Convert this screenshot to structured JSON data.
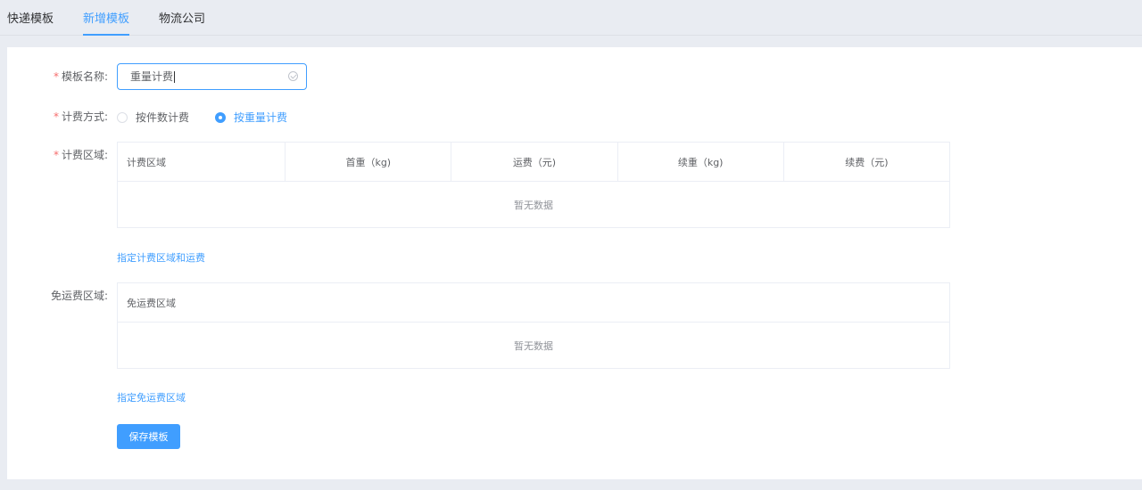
{
  "tabs": [
    {
      "label": "快递模板",
      "active": false
    },
    {
      "label": "新增模板",
      "active": true
    },
    {
      "label": "物流公司",
      "active": false
    }
  ],
  "form": {
    "name": {
      "required_mark": "*",
      "label": "模板名称:",
      "value": "重量计费"
    },
    "billing_method": {
      "required_mark": "*",
      "label": "计费方式:",
      "options": [
        {
          "label": "按件数计费",
          "checked": false
        },
        {
          "label": "按重量计费",
          "checked": true
        }
      ]
    },
    "billing_area": {
      "required_mark": "*",
      "label": "计费区域:",
      "columns": [
        "计费区域",
        "首重（kg)",
        "运费（元)",
        "续重（kg)",
        "续费（元)"
      ],
      "rows": [],
      "empty_text": "暂无数据",
      "add_link": "指定计费区域和运费"
    },
    "free_area": {
      "label": "免运费区域:",
      "columns": [
        "免运费区域"
      ],
      "rows": [],
      "empty_text": "暂无数据",
      "add_link": "指定免运费区域"
    },
    "save_button": "保存模板"
  },
  "colors": {
    "accent": "#409eff",
    "required": "#f56c6c",
    "page_bg": "#e9ecf2"
  }
}
